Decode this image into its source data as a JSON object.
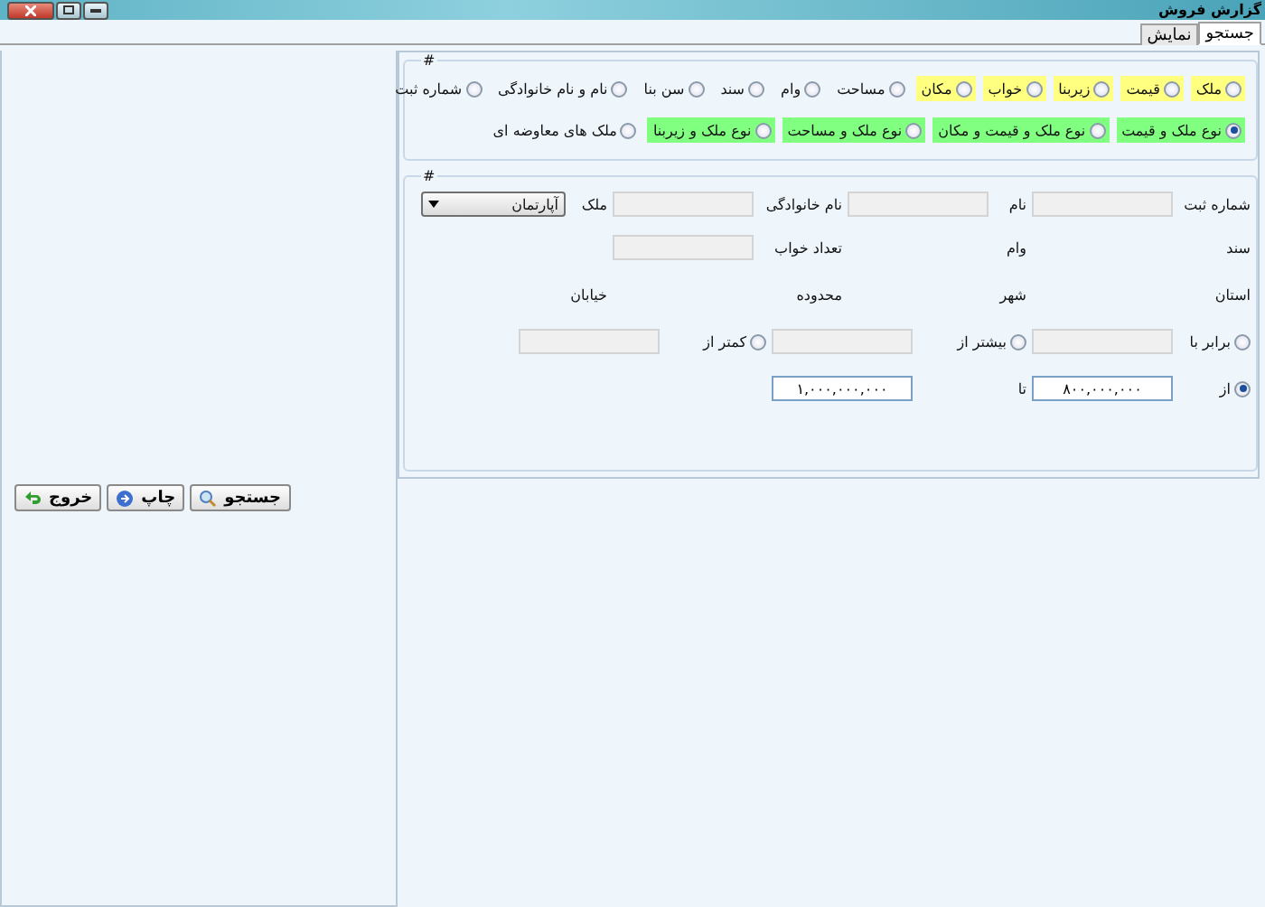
{
  "window": {
    "title": "گزارش فروش"
  },
  "tabs": [
    {
      "label": "جستجو",
      "selected": true
    },
    {
      "label": "نمایش",
      "selected": false
    }
  ],
  "sort_group": {
    "legend": "#",
    "rows": [
      {
        "options": [
          {
            "label": "ملک",
            "selected": false,
            "color": "#ffff80"
          },
          {
            "label": "قیمت",
            "selected": false,
            "color": "#ffff80"
          },
          {
            "label": "زیربنا",
            "selected": false,
            "color": "#ffff80"
          },
          {
            "label": "خواب",
            "selected": false,
            "color": "#ffff80"
          },
          {
            "label": "مکان",
            "selected": false,
            "color": "#ffff80"
          },
          {
            "label": "مساحت",
            "selected": false
          },
          {
            "label": "وام",
            "selected": false
          },
          {
            "label": "سند",
            "selected": false
          },
          {
            "label": "سن بنا",
            "selected": false
          },
          {
            "label": "نام و نام خانوادگی",
            "selected": false
          },
          {
            "label": "شماره ثبت",
            "selected": false
          }
        ]
      },
      {
        "options": [
          {
            "label": "نوع ملک و قیمت",
            "selected": true,
            "color": "#80ff80"
          },
          {
            "label": "نوع ملک و قیمت و مکان",
            "selected": false,
            "color": "#80ff80"
          },
          {
            "label": "نوع ملک و مساحت",
            "selected": false,
            "color": "#80ff80"
          },
          {
            "label": "نوع ملک و زیربنا",
            "selected": false,
            "color": "#80ff80"
          },
          {
            "label": "ملک های معاوضه ای",
            "selected": false
          }
        ]
      }
    ]
  },
  "filter_group": {
    "legend": "#",
    "rows": [
      {
        "kind": "grid8",
        "items": [
          {
            "kind": "label",
            "text": "شماره ثبت"
          },
          {
            "kind": "field",
            "disabled": true
          },
          {
            "kind": "label",
            "text": "نام"
          },
          {
            "kind": "field",
            "disabled": true
          },
          {
            "kind": "label",
            "text": "نام خانوادگی"
          },
          {
            "kind": "field",
            "disabled": true
          },
          {
            "kind": "label",
            "text": "ملک"
          },
          {
            "kind": "select",
            "value": "آپارتمان"
          }
        ]
      },
      {
        "kind": "grid8",
        "items": [
          {
            "kind": "label",
            "text": "سند"
          },
          {
            "kind": "label",
            "text": "وام"
          },
          {
            "kind": "label",
            "text": "تعداد خواب"
          },
          {
            "kind": "field",
            "disabled": true
          }
        ]
      },
      {
        "kind": "grid8",
        "items": [
          {
            "kind": "label",
            "text": "استان"
          },
          {
            "kind": "label",
            "text": "شهر"
          },
          {
            "kind": "label",
            "text": "محدوده"
          },
          {
            "kind": "label",
            "text": "خیابان"
          }
        ]
      },
      {
        "kind": "grid6",
        "items": [
          {
            "kind": "radio",
            "text": "برابر با",
            "selected": false
          },
          {
            "kind": "field",
            "disabled": true
          },
          {
            "kind": "radio",
            "text": "بیشتر از",
            "selected": false
          },
          {
            "kind": "field",
            "disabled": true
          },
          {
            "kind": "radio",
            "text": "کمتر از",
            "selected": false
          },
          {
            "kind": "field",
            "disabled": true
          }
        ]
      },
      {
        "kind": "grid6",
        "items": [
          {
            "kind": "radio",
            "text": "از",
            "selected": true
          },
          {
            "kind": "field",
            "disabled": false,
            "value": "۸۰۰,۰۰۰,۰۰۰"
          },
          {
            "kind": "label",
            "text": "تا"
          },
          {
            "kind": "field",
            "disabled": false,
            "value": "۱,۰۰۰,۰۰۰,۰۰۰"
          }
        ]
      }
    ]
  },
  "buttons": [
    {
      "label": "جستجو",
      "kind": "search"
    },
    {
      "label": "چاپ",
      "kind": "print"
    },
    {
      "label": "خروج",
      "kind": "exit"
    }
  ]
}
